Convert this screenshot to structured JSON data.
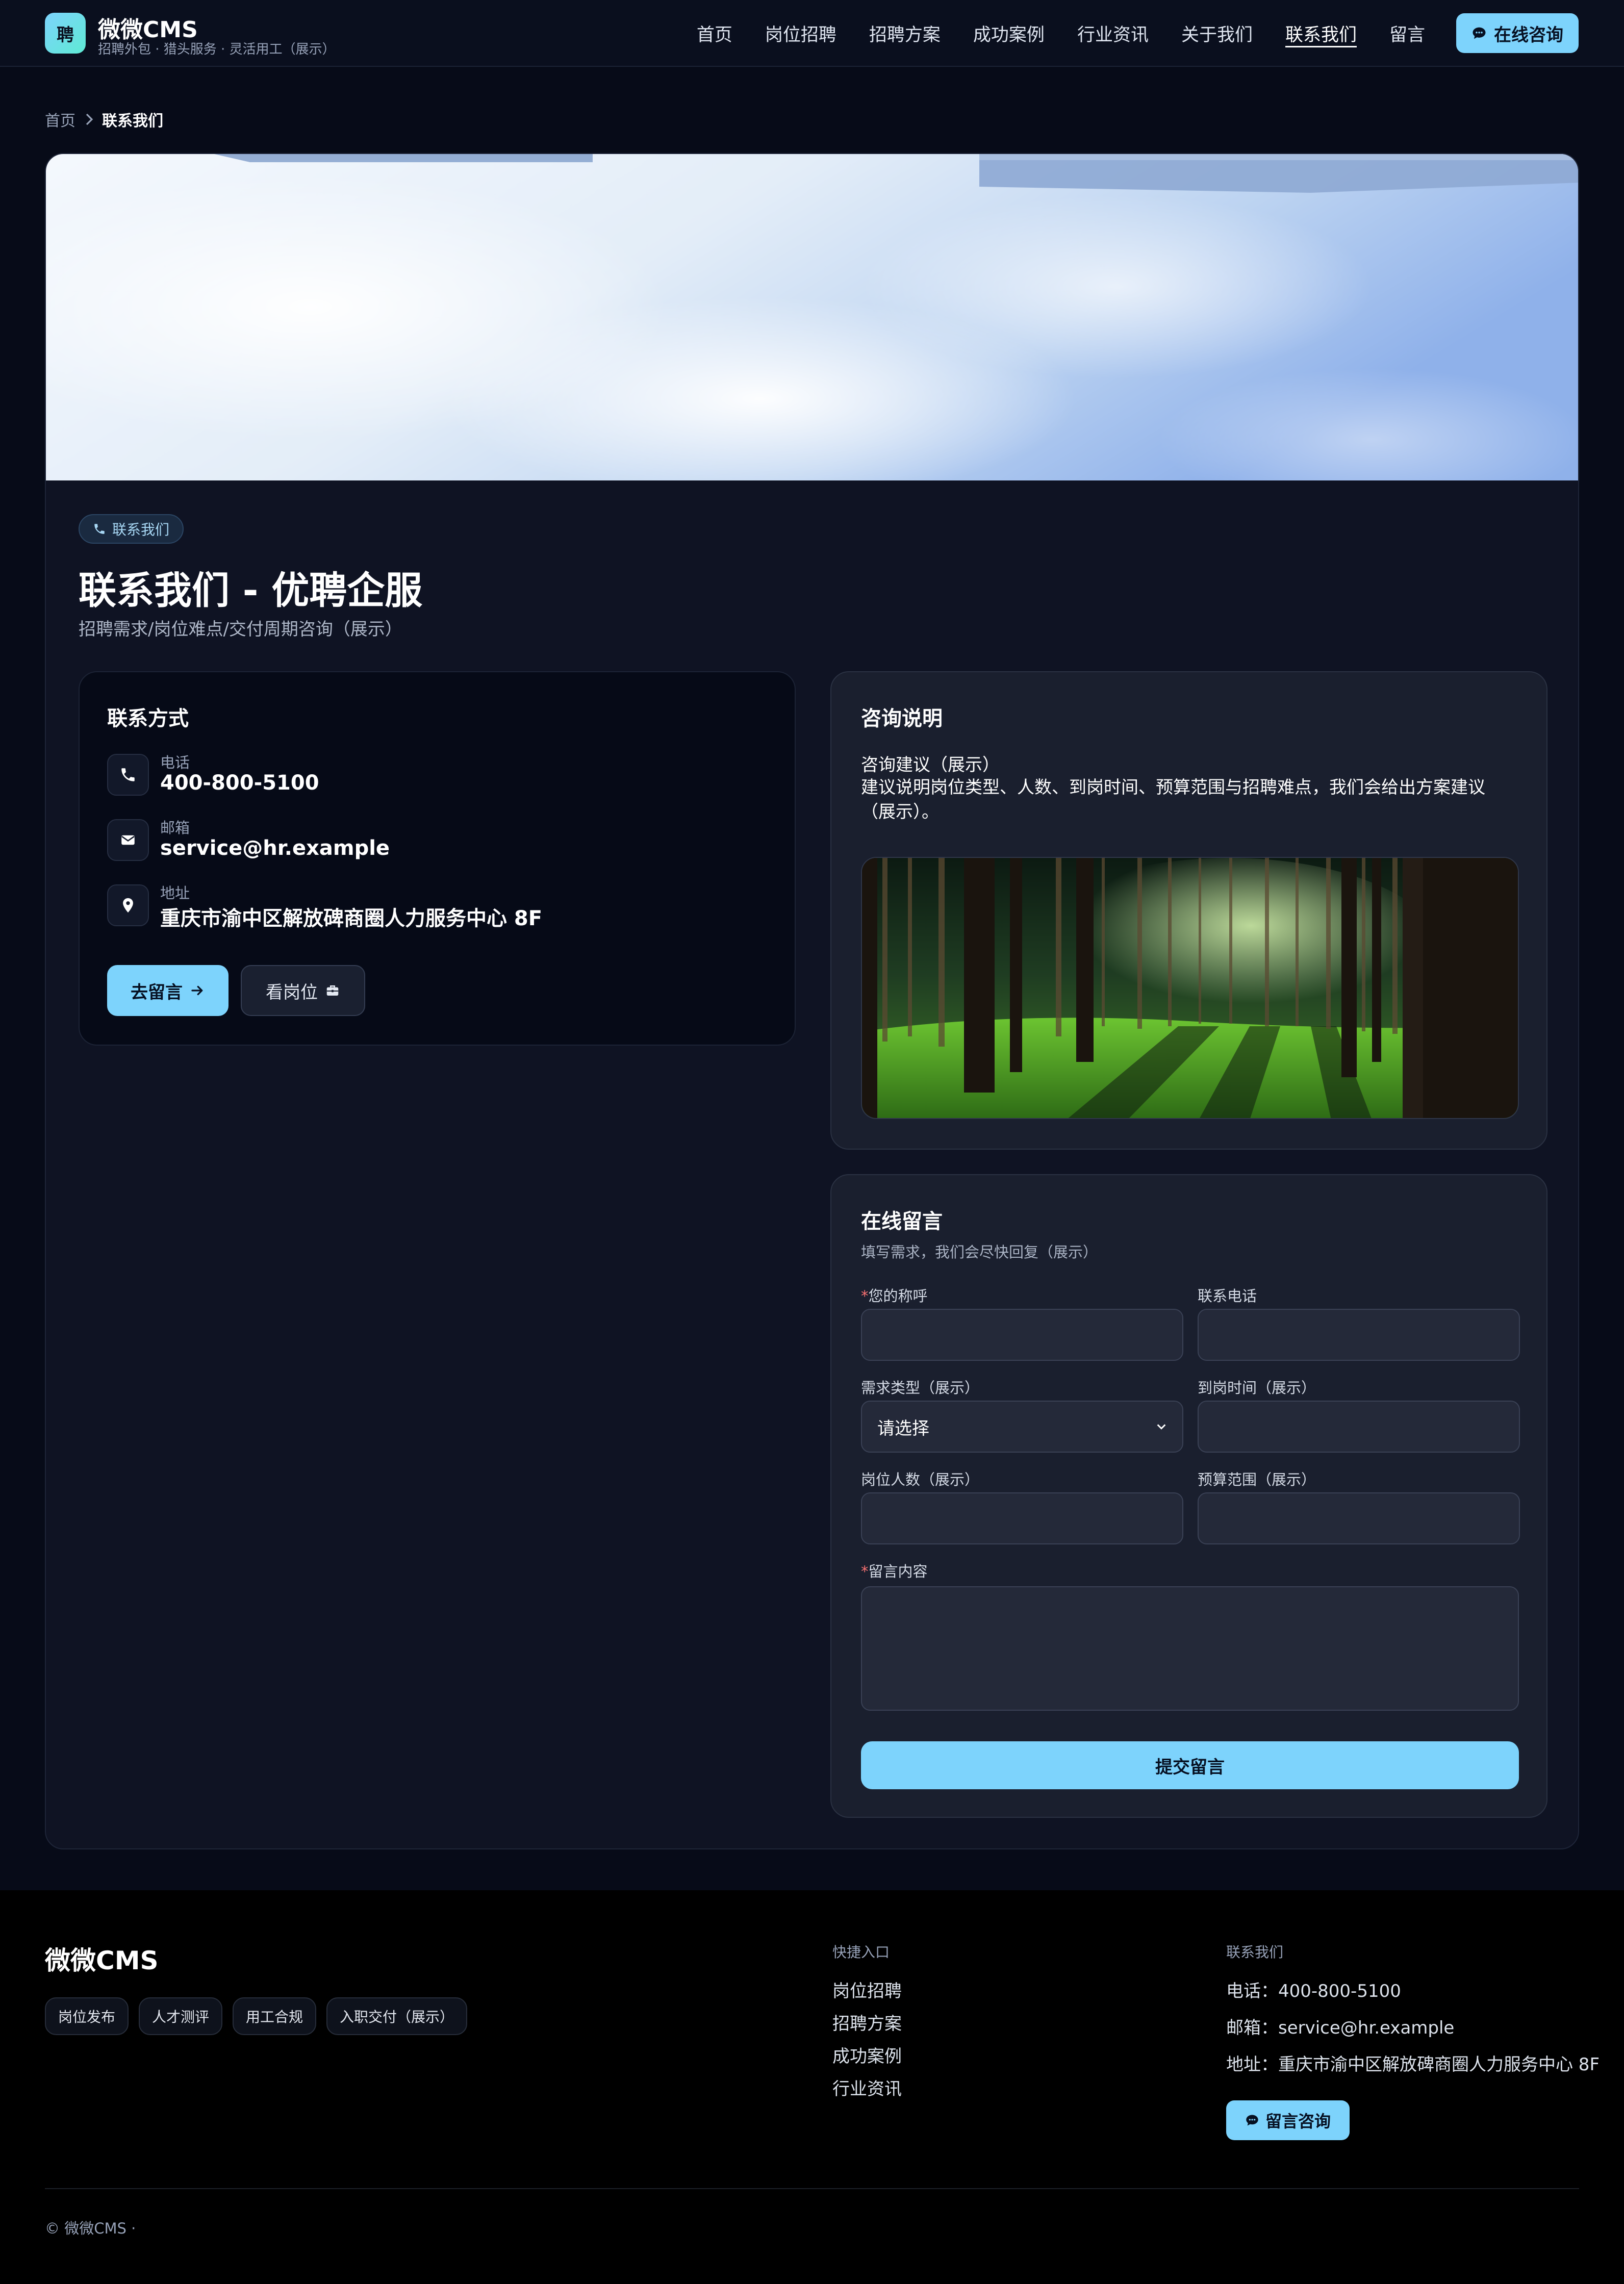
{
  "header": {
    "logo_char": "聘",
    "brand_name": "微微CMS",
    "brand_tagline": "招聘外包 · 猎头服务 · 灵活用工（展示）",
    "nav": [
      {
        "label": "首页"
      },
      {
        "label": "岗位招聘"
      },
      {
        "label": "招聘方案"
      },
      {
        "label": "成功案例"
      },
      {
        "label": "行业资讯"
      },
      {
        "label": "关于我们"
      },
      {
        "label": "联系我们",
        "active": true
      },
      {
        "label": "留言"
      }
    ],
    "consult_button": "在线咨询"
  },
  "breadcrumb": {
    "home": "首页",
    "current": "联系我们"
  },
  "page": {
    "badge": "联系我们",
    "title": "联系我们 - 优聘企服",
    "subtitle": "招聘需求/岗位难点/交付周期咨询（展示）"
  },
  "contact": {
    "title": "联系方式",
    "phone_label": "电话",
    "phone": "400-800-5100",
    "email_label": "邮箱",
    "email": "service@hr.example",
    "address_label": "地址",
    "address": "重庆市渝中区解放碑商圈人力服务中心 8F",
    "message_button": "去留言",
    "jobs_button": "看岗位"
  },
  "consult": {
    "title": "咨询说明",
    "heading": "咨询建议（展示）",
    "description": "建议说明岗位类型、人数、到岗时间、预算范围与招聘难点，我们会给出方案建议（展示）。"
  },
  "form": {
    "title": "在线留言",
    "subtitle": "填写需求，我们会尽快回复（展示）",
    "required_mark": "*",
    "name_label": "您的称呼",
    "phone_label": "联系电话",
    "type_label": "需求类型（展示）",
    "type_value": "请选择",
    "arrival_label": "到岗时间（展示）",
    "headcount_label": "岗位人数（展示）",
    "budget_label": "预算范围（展示）",
    "content_label": "留言内容",
    "submit": "提交留言"
  },
  "footer": {
    "brand": "微微CMS",
    "tags": [
      "岗位发布",
      "人才测评",
      "用工合规",
      "入职交付（展示）"
    ],
    "quick_title": "快捷入口",
    "quick_links": [
      "岗位招聘",
      "招聘方案",
      "成功案例",
      "行业资讯"
    ],
    "contact_title": "联系我们",
    "phone": "电话：400-800-5100",
    "email": "邮箱：service@hr.example",
    "address": "地址：重庆市渝中区解放碑商圈人力服务中心 8F",
    "message_button": "留言咨询",
    "copyright": "© 微微CMS ·"
  },
  "colors": {
    "accent": "#7dd3fc",
    "background": "#070b18",
    "card": "#1a1f2e"
  }
}
